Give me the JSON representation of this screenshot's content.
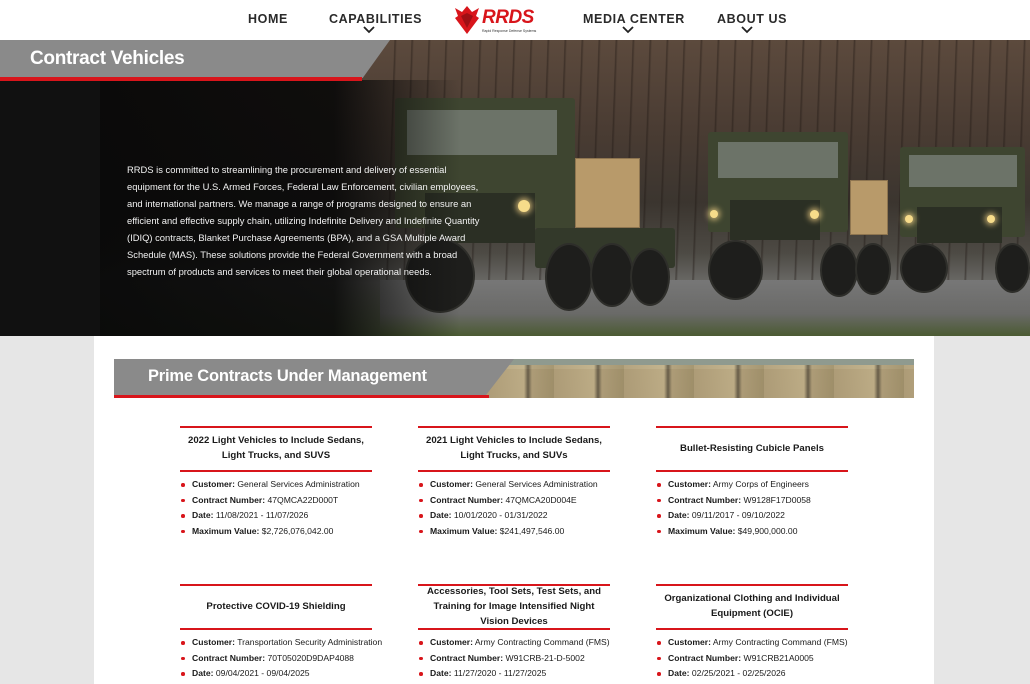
{
  "nav": {
    "items": [
      {
        "label": "HOME"
      },
      {
        "label": "CAPABILITIES"
      },
      {
        "label": "MEDIA CENTER"
      },
      {
        "label": "ABOUT US"
      }
    ],
    "logo": {
      "text": "RRDS",
      "subtext": "Rapid Response Defense Systems"
    }
  },
  "hero": {
    "title": "Contract Vehicles",
    "description": "RRDS is committed to streamlining the procurement and delivery of essential equipment for the U.S. Armed Forces, Federal Law Enforcement, civilian employees, and international partners. We manage a range of programs designed to ensure an efficient and effective supply chain, utilizing Indefinite Delivery and Indefinite Quantity (IDIQ) contracts, Blanket Purchase Agreements (BPA), and a GSA Multiple Award Schedule (MAS). These solutions provide the Federal Government with a broad spectrum of products and services to meet their global operational needs."
  },
  "prime": {
    "title": "Prime Contracts Under Management",
    "cards": [
      {
        "title": "2022 Light Vehicles to Include Sedans, Light Trucks, and SUVS",
        "details": [
          {
            "label": "Customer:",
            "value": "General Services Administration"
          },
          {
            "label": "Contract Number:",
            "value": "47QMCA22D000T"
          },
          {
            "label": "Date:",
            "value": "11/08/2021 - 11/07/2026"
          },
          {
            "label": "Maximum Value:",
            "value": "$2,726,076,042.00"
          }
        ]
      },
      {
        "title": "2021 Light Vehicles to Include Sedans, Light Trucks, and SUVs",
        "details": [
          {
            "label": "Customer:",
            "value": "General Services Administration"
          },
          {
            "label": "Contract Number:",
            "value": "47QMCA20D004E"
          },
          {
            "label": "Date:",
            "value": "10/01/2020 - 01/31/2022"
          },
          {
            "label": "Maximum Value:",
            "value": "$241,497,546.00"
          }
        ]
      },
      {
        "title": "Bullet-Resisting Cubicle Panels",
        "details": [
          {
            "label": "Customer:",
            "value": "Army Corps of Engineers"
          },
          {
            "label": "Contract Number:",
            "value": "W9128F17D0058"
          },
          {
            "label": "Date:",
            "value": "09/11/2017 - 09/10/2022"
          },
          {
            "label": "Maximum Value:",
            "value": "$49,900,000.00"
          }
        ]
      },
      {
        "title": "Protective COVID-19 Shielding",
        "details": [
          {
            "label": "Customer:",
            "value": "Transportation Security Administration"
          },
          {
            "label": "Contract Number:",
            "value": "70T05020D9DAP4088"
          },
          {
            "label": "Date:",
            "value": "09/04/2021 - 09/04/2025"
          }
        ]
      },
      {
        "title": "Accessories, Tool Sets, Test Sets, and Training for Image Intensified Night Vision Devices",
        "details": [
          {
            "label": "Customer:",
            "value": "Army Contracting Command (FMS)"
          },
          {
            "label": "Contract Number:",
            "value": "W91CRB-21-D-5002"
          },
          {
            "label": "Date:",
            "value": "11/27/2020 - 11/27/2025"
          }
        ]
      },
      {
        "title": "Organizational Clothing and Individual Equipment (OCIE)",
        "details": [
          {
            "label": "Customer:",
            "value": "Army Contracting Command (FMS)"
          },
          {
            "label": "Contract Number:",
            "value": "W91CRB21A0005"
          },
          {
            "label": "Date:",
            "value": "02/25/2021 - 02/25/2026"
          }
        ]
      }
    ]
  },
  "colors": {
    "accent": "#d8151b",
    "bar_gray": "#8a8a8a",
    "page_bg": "#e6e6e6"
  }
}
